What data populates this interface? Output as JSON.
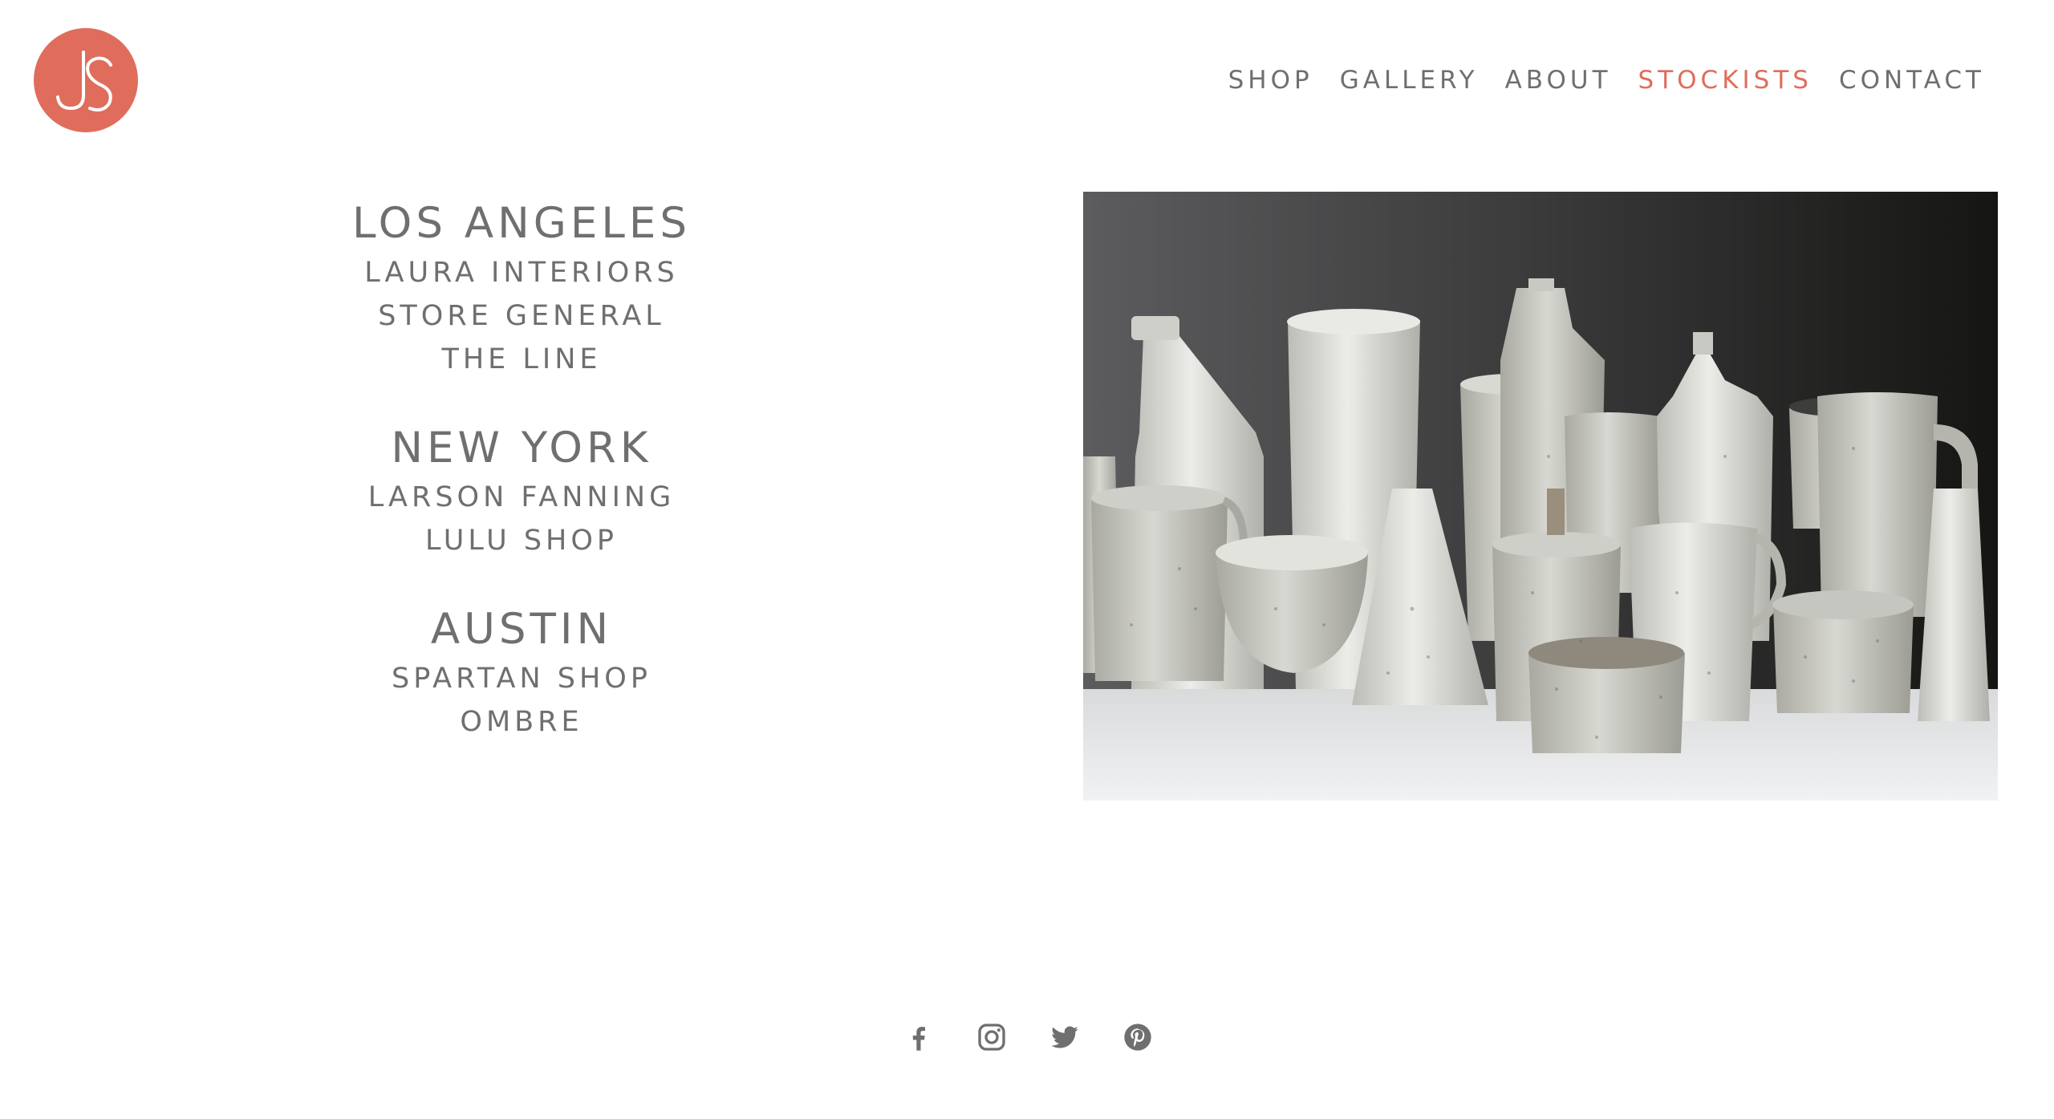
{
  "brand": {
    "logo_text": "JS",
    "accent_color": "#e06d5c",
    "text_color": "#6f6f6f"
  },
  "nav": {
    "items": [
      {
        "label": "SHOP",
        "active": false
      },
      {
        "label": "GALLERY",
        "active": false
      },
      {
        "label": "ABOUT",
        "active": false
      },
      {
        "label": "STOCKISTS",
        "active": true
      },
      {
        "label": "CONTACT",
        "active": false
      }
    ]
  },
  "stockists": [
    {
      "city": "LOS ANGELES",
      "stores": [
        "LAURA INTERIORS",
        "STORE GENERAL",
        "THE LINE"
      ]
    },
    {
      "city": "NEW YORK",
      "stores": [
        "LARSON FANNING",
        "LULU SHOP"
      ]
    },
    {
      "city": "AUSTIN",
      "stores": [
        "SPARTAN SHOP",
        "OMBRE"
      ]
    }
  ],
  "hero": {
    "subject": "white speckled ceramic vessels photograph"
  },
  "social": [
    {
      "icon": "facebook-icon"
    },
    {
      "icon": "instagram-icon"
    },
    {
      "icon": "twitter-icon"
    },
    {
      "icon": "pinterest-icon"
    }
  ]
}
